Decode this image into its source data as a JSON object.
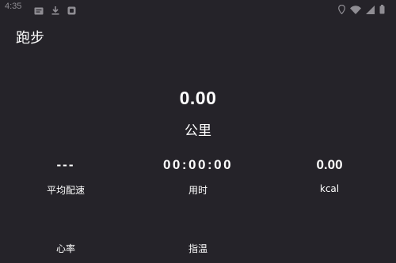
{
  "status_bar": {
    "time": "4:35",
    "left_icons": [
      "message-icon",
      "download-icon",
      "app-icon"
    ],
    "right_icons": [
      "location-icon",
      "wifi-icon",
      "signal-icon",
      "battery-icon"
    ]
  },
  "header": {
    "title": "跑步"
  },
  "distance": {
    "value": "0.00",
    "unit": "公里"
  },
  "metrics": [
    {
      "value": "---",
      "label": "平均配速"
    },
    {
      "value": "00:00:00",
      "label": "用时"
    },
    {
      "value": "0.00",
      "label": "kcal"
    }
  ],
  "bottom_metrics": [
    {
      "label": "心率"
    },
    {
      "label": "指温"
    }
  ],
  "colors": {
    "background": "#252329",
    "text": "#ffffff",
    "status_text": "#8f8d93"
  }
}
